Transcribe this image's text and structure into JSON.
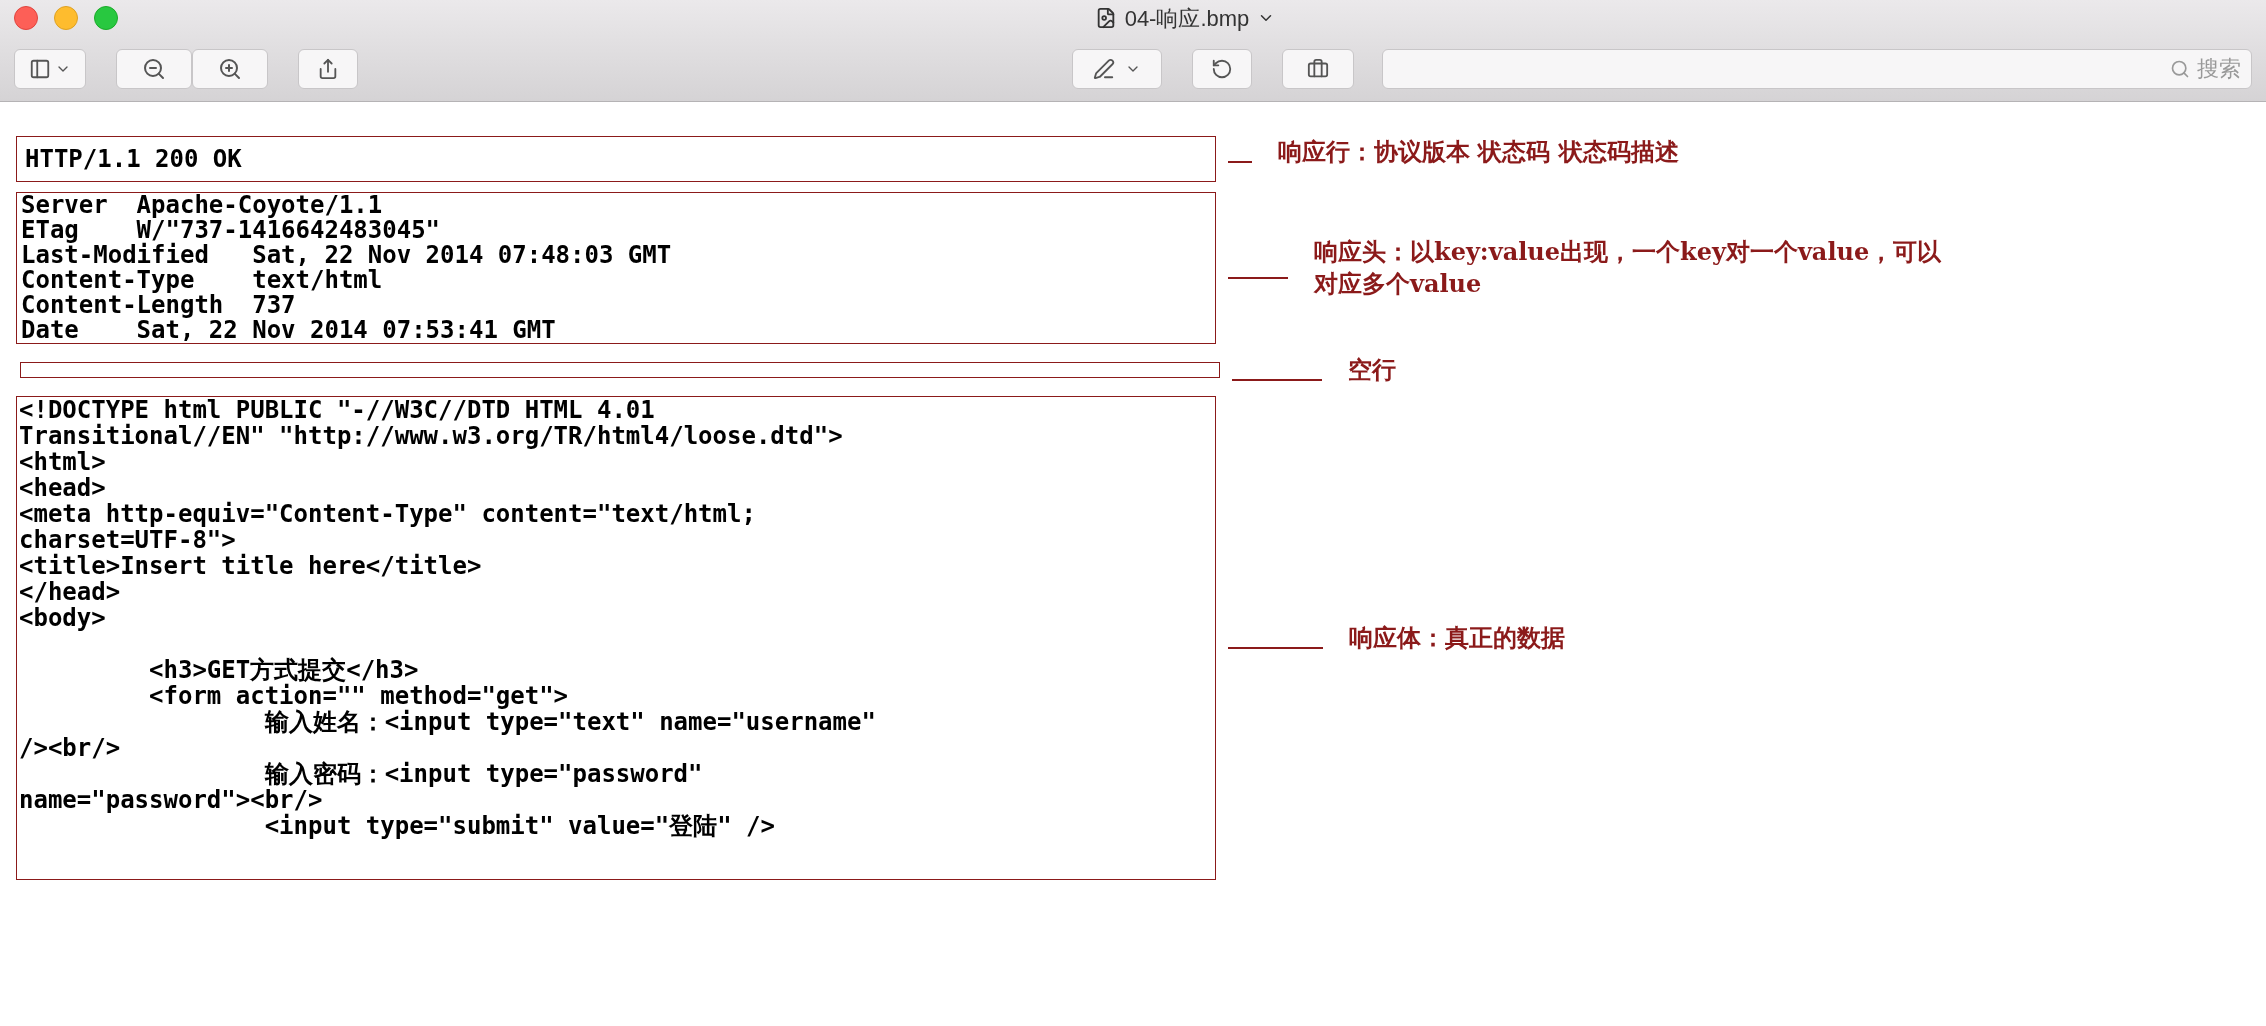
{
  "window": {
    "title": "04-响应.bmp"
  },
  "search": {
    "placeholder": "搜索"
  },
  "sections": [
    {
      "kind": "status",
      "blocks": [
        [
          "HTTP/1.1 200 OK"
        ]
      ],
      "note": [
        "响应行：协议版本 状态码 状态码描述"
      ]
    },
    {
      "kind": "headers",
      "blocks": [
        [
          "Server  Apache-Coyote/1.1",
          "ETag    W/\"737-1416642483045\"",
          "Last-Modified   Sat, 22 Nov 2014 07:48:03 GMT",
          "Content-Type    text/html",
          "Content-Length  737",
          "Date    Sat, 22 Nov 2014 07:53:41 GMT"
        ]
      ],
      "note": [
        "响应头：以key:value出现，一个key对一个value，可以",
        "对应多个value"
      ]
    },
    {
      "kind": "blank",
      "note": [
        "空行"
      ]
    },
    {
      "kind": "body",
      "blocks": [
        [
          "<!DOCTYPE html PUBLIC \"-//W3C//DTD HTML 4.01",
          "Transitional//EN\" \"http://www.w3.org/TR/html4/loose.dtd\">",
          "<html>",
          "<head>",
          "<meta http-equiv=\"Content-Type\" content=\"text/html;",
          "charset=UTF-8\">",
          "<title>Insert title here</title>",
          "</head>",
          "<body>"
        ],
        [
          "         <h3>GET方式提交</h3>",
          "         <form action=\"\" method=\"get\">",
          "                 输入姓名：<input type=\"text\" name=\"username\"",
          "/><br/>",
          "                 输入密码：<input type=\"password\"",
          "name=\"password\"><br/>",
          "                 <input type=\"submit\" value=\"登陆\" />"
        ]
      ],
      "note": [
        "响应体：真正的数据"
      ]
    }
  ]
}
